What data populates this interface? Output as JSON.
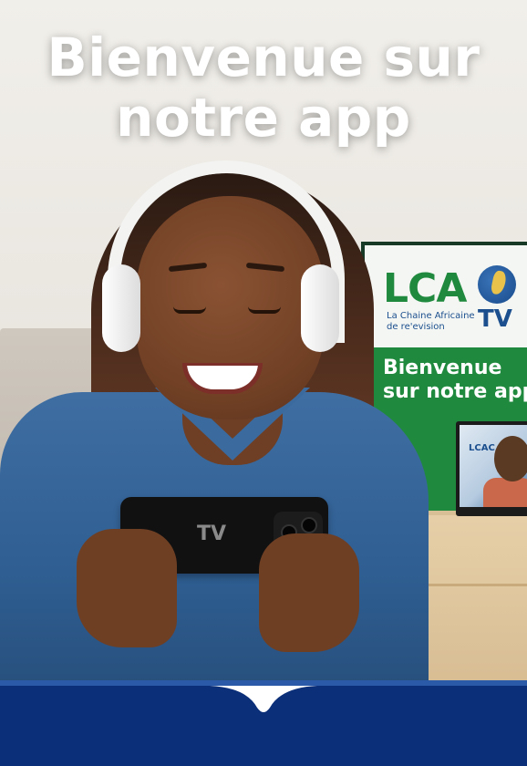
{
  "welcome_screen": {
    "headline_line1": "Bienvenue sur",
    "headline_line2": "notre app"
  },
  "background_poster": {
    "logo_text": "LCA",
    "logo_tv": "TV",
    "logo_subtitle": "La Chaine Africaine de re'evision",
    "message": "Bienvenue sur notre app"
  },
  "mini_tv": {
    "logo_text": "LCAC"
  },
  "phone": {
    "label": "TV"
  },
  "colors": {
    "brand_blue": "#0c2f79",
    "accent_blue": "#2a5aa8",
    "brand_green": "#1f8a3e"
  }
}
